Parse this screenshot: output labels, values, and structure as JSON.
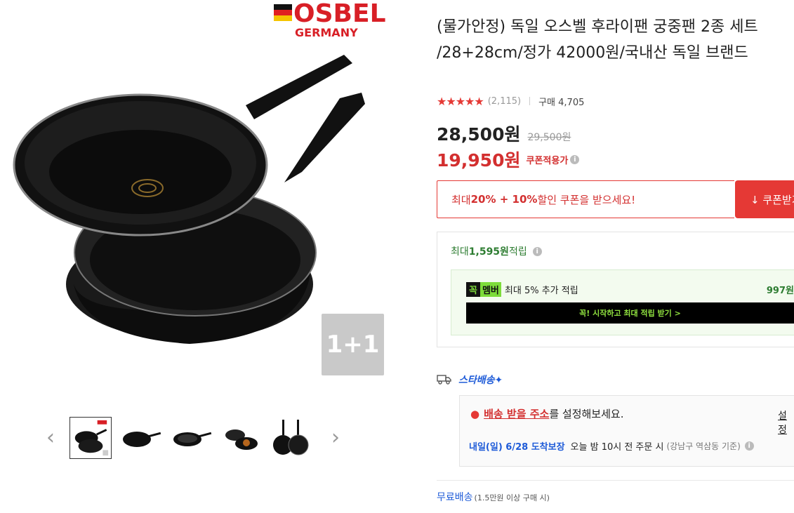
{
  "brand": {
    "name": "OSBEL",
    "country": "GERMANY"
  },
  "gallery": {
    "badge": "1+1",
    "prev_icon": "chevron-left-icon",
    "next_icon": "chevron-right-icon",
    "thumbnails": [
      "thumb-1",
      "thumb-2",
      "thumb-3",
      "thumb-4",
      "thumb-5"
    ],
    "selected_thumbnail": 0
  },
  "product": {
    "title": "(물가안정) 독일 오스벨 후라이팬 궁중팬 2종 세트 /28+28cm/정가 42000원/국내산 독일 브랜드",
    "rating_stars": "★★★★★",
    "review_count": "(2,115)",
    "purchase_count": "구매 4,705",
    "price": "28,500원",
    "original_price": "29,500원",
    "coupon_price": "19,950원",
    "coupon_price_label": "쿠폰적용가"
  },
  "coupon": {
    "text_prefix": "최대 ",
    "text_bold": "20% + 10%",
    "text_suffix": " 할인 쿠폰을 받으세요!",
    "button_label": "↓ 쿠폰받기"
  },
  "reward": {
    "prefix": "최대 ",
    "amount": "1,595원",
    "suffix": " 적립",
    "member_logo_a": "꼭",
    "member_logo_b": "멤버",
    "member_text": "최대 5% 추가 적립",
    "member_amount": "997원",
    "member_button": "꼭! 시작하고 최대 적립 받기 >"
  },
  "delivery": {
    "service": "스타배송✦",
    "address_link": "배송 받을 주소",
    "address_text": "를 설정해보세요.",
    "address_set": "설정",
    "arrive_date": "내일(일) 6/28 도착보장",
    "arrive_text": "오늘 밤 10시 전 주문 시",
    "arrive_sub": "(강남구 역삼동 기준)",
    "free_shipping": "무료배송",
    "free_shipping_sub": "(1.5만원 이상 구매 시)"
  },
  "colors": {
    "accent": "#e53935",
    "blue": "#1e5bd8",
    "green": "#2e7d32"
  }
}
